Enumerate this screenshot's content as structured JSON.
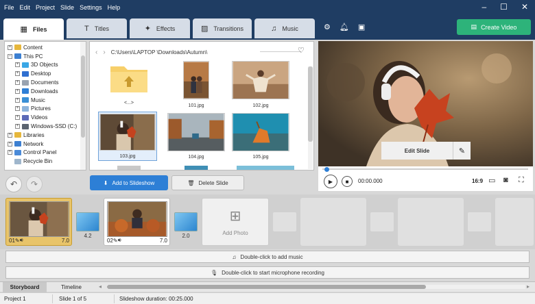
{
  "menu": [
    "File",
    "Edit",
    "Project",
    "Slide",
    "Settings",
    "Help"
  ],
  "window_controls": {
    "minimize": "–",
    "maximize": "☐",
    "close": "✕"
  },
  "tabs": [
    {
      "label": "Files",
      "icon": "files-add-icon",
      "active": true
    },
    {
      "label": "Titles",
      "icon": "text-t-icon",
      "active": false
    },
    {
      "label": "Effects",
      "icon": "magic-star-icon",
      "active": false
    },
    {
      "label": "Transitions",
      "icon": "transition-icon",
      "active": false
    },
    {
      "label": "Music",
      "icon": "music-note-icon",
      "active": false
    }
  ],
  "header_icons": [
    "gear-icon",
    "bell-icon",
    "picture-icon"
  ],
  "create_video": {
    "label": "Create Video",
    "color": "#2db37a"
  },
  "tree": [
    {
      "label": "Content",
      "indent": 0,
      "expand": "+",
      "color": "#e6b73c"
    },
    {
      "label": "This PC",
      "indent": 0,
      "expand": "–",
      "color": "#3c7fd1"
    },
    {
      "label": "3D Objects",
      "indent": 1,
      "expand": "+",
      "color": "#3aa7e6"
    },
    {
      "label": "Desktop",
      "indent": 1,
      "expand": "+",
      "color": "#2f6fd0"
    },
    {
      "label": "Documents",
      "indent": 1,
      "expand": "+",
      "color": "#9aa3b0"
    },
    {
      "label": "Downloads",
      "indent": 1,
      "expand": "+",
      "color": "#2f7fd6"
    },
    {
      "label": "Music",
      "indent": 1,
      "expand": "+",
      "color": "#3a8fd6"
    },
    {
      "label": "Pictures",
      "indent": 1,
      "expand": "+",
      "color": "#8db4dc"
    },
    {
      "label": "Videos",
      "indent": 1,
      "expand": "+",
      "color": "#5c6ab8"
    },
    {
      "label": "Windows-SSD (C:)",
      "indent": 1,
      "expand": "+",
      "color": "#5b6470"
    },
    {
      "label": "Libraries",
      "indent": 0,
      "expand": "+",
      "color": "#e6b73c"
    },
    {
      "label": "Network",
      "indent": 0,
      "expand": "+",
      "color": "#3c7fd1"
    },
    {
      "label": "Control Panel",
      "indent": 0,
      "expand": "+",
      "color": "#4a8ad8"
    },
    {
      "label": "Recycle Bin",
      "indent": 0,
      "expand": "",
      "color": "#9fb6cc"
    }
  ],
  "path": "C:\\Users\\LAPTOP \\Downloads\\Autumn\\",
  "files": [
    {
      "name": "<...>",
      "kind": "folder"
    },
    {
      "name": "101.jpg",
      "kind": "photo"
    },
    {
      "name": "102.jpg",
      "kind": "photo"
    },
    {
      "name": "103.jpg",
      "kind": "photo",
      "selected": true
    },
    {
      "name": "104.jpg",
      "kind": "photo"
    },
    {
      "name": "105.jpg",
      "kind": "photo"
    }
  ],
  "actions": {
    "add": "Add to Slideshow",
    "delete": "Delete Slide"
  },
  "preview": {
    "edit_label": "Edit Slide"
  },
  "player": {
    "time": "00:00.000",
    "ratio": "16:9"
  },
  "slides": [
    {
      "num": "01",
      "duration": "7.0",
      "selected": true
    },
    {
      "num": "02",
      "duration": "7.0",
      "selected": false
    }
  ],
  "transitions": [
    "4.2",
    "2.0"
  ],
  "add_photo": "Add Photo",
  "tracks": {
    "music": "Double-click to add music",
    "mic": "Double-click to start microphone recording"
  },
  "view_tabs": [
    "Storyboard",
    "Timeline"
  ],
  "status": {
    "project": "Project 1",
    "slide": "Slide 1 of 5",
    "duration": "Slideshow duration: 00:25.000"
  }
}
